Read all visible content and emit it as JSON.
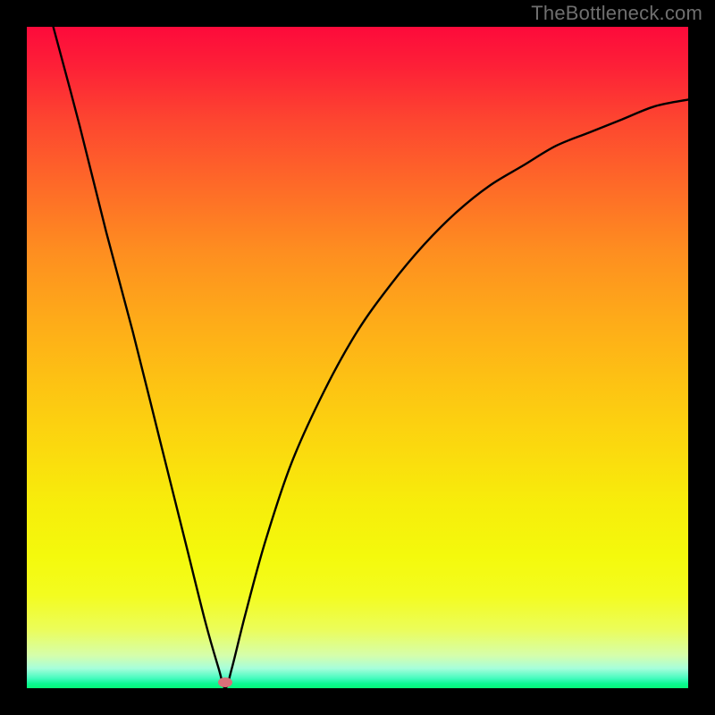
{
  "watermark": "TheBottleneck.com",
  "colors": {
    "frame": "#000000",
    "curve": "#000000",
    "marker": "#d97079",
    "gradient_top": "#fd0a3b",
    "gradient_bottom": "#06f878"
  },
  "chart_data": {
    "type": "line",
    "title": "",
    "xlabel": "",
    "ylabel": "",
    "xlim": [
      0,
      100
    ],
    "ylim": [
      0,
      100
    ],
    "grid": false,
    "legend": false,
    "series": [
      {
        "name": "bottleneck-curve",
        "x": [
          4,
          8,
          12,
          16,
          20,
          24,
          27,
          29,
          30,
          31,
          33,
          36,
          40,
          45,
          50,
          55,
          60,
          65,
          70,
          75,
          80,
          85,
          90,
          95,
          100
        ],
        "y": [
          100,
          85,
          69,
          54,
          38,
          22,
          10,
          3,
          0,
          3,
          11,
          22,
          34,
          45,
          54,
          61,
          67,
          72,
          76,
          79,
          82,
          84,
          86,
          88,
          89
        ]
      }
    ],
    "annotations": [
      {
        "name": "min-marker",
        "x": 30,
        "y": 0
      }
    ]
  }
}
